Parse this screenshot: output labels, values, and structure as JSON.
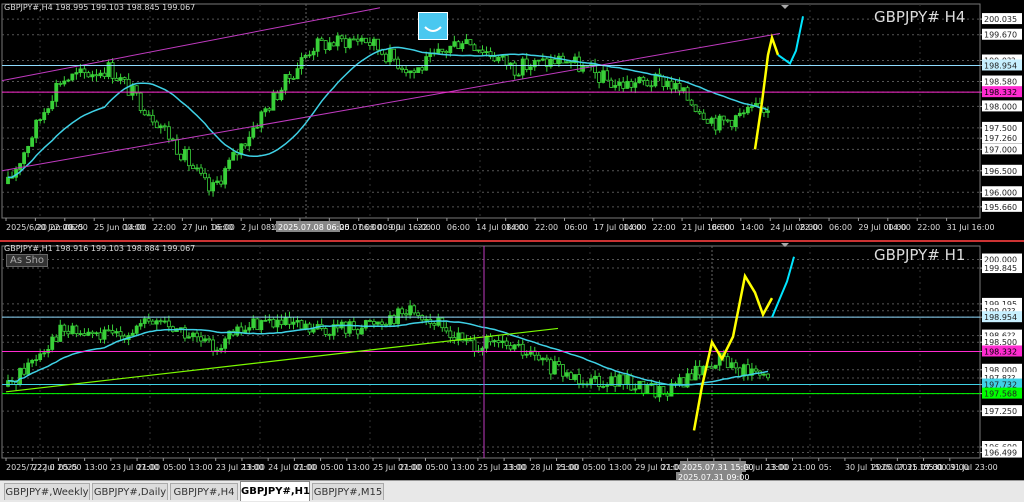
{
  "window": {
    "tabs": [
      {
        "label": "GBPJPY#,Weekly",
        "active": false
      },
      {
        "label": "GBPJPY#,Daily",
        "active": false
      },
      {
        "label": "GBPJPY#,H4",
        "active": false
      },
      {
        "label": "GBPJPY#,H1",
        "active": true
      },
      {
        "label": "GBPJPY#,M15",
        "active": false
      }
    ]
  },
  "as_show_label": "As Sho",
  "colors": {
    "candle": "#39d039",
    "ma": "#3fd1e6",
    "channel": "#c03ac0",
    "magenta_line": "#ff2bd0",
    "trend_green": "#7cfc00",
    "yellow_path": "#ffff00",
    "forecast_path": "#00e5ff",
    "green_level": "#00ff00"
  },
  "pane_h4": {
    "info": "GBPJPY#,H4  198.995 199.103 198.845 199.067",
    "symbol_label": "GBPJPY#  H4",
    "price_min": 195.4,
    "price_max": 200.2,
    "price_ticks": [
      "200.035",
      "199.670",
      "199.0??",
      "198.954",
      "198.580",
      "198.332",
      "198.000",
      "197.500",
      "197.260",
      "197.000",
      "196.500",
      "196.000",
      "195.660"
    ],
    "price_tick_values": [
      200.035,
      199.67,
      199.07,
      198.954,
      198.58,
      198.332,
      198.0,
      197.5,
      197.26,
      197.0,
      196.5,
      196.0,
      195.66
    ],
    "time_labels": [
      "2025/6/20 22:00",
      "20 Jun 2025",
      "06:00",
      "25 Jun 00:00",
      "14:00",
      "22:00",
      "27 Jun 16:00",
      "06:00",
      "2 Jul 08:00",
      "14:00",
      "22:00",
      "2025.07.08 00:00",
      "06:00",
      "9 Jul 16:00",
      "22:00",
      "06:00",
      "14 Jul 08:00",
      "14:00",
      "22:00",
      "06:00",
      "17 Jul 00:00",
      "14:00",
      "22:00",
      "21 Jul 16:00",
      "06:00",
      "14:00",
      "24 Jul 08:00",
      "22:00",
      "06:00",
      "29 Jul 00:00",
      "14:00",
      "22:00",
      "31 Jul 16:00"
    ],
    "crosshair_time": "2025.07.08 06:00"
  },
  "pane_h1": {
    "info": "GBPJPY#,H1  198.916 199.103 198.884 199.067",
    "symbol_label": "GBPJPY#  H1",
    "price_min": 196.4,
    "price_max": 200.1,
    "price_ticks": [
      "200.000",
      "199.845",
      "199.195",
      "199.0??",
      "198.954",
      "198.6??",
      "198.500",
      "198.332",
      "198.000",
      "197.8??",
      "197.732",
      "197.568",
      "197.250",
      "196.600",
      "196.499"
    ],
    "price_tick_values": [
      200.0,
      199.845,
      199.195,
      199.07,
      198.954,
      198.62,
      198.5,
      198.332,
      198.0,
      197.85,
      197.732,
      197.568,
      197.25,
      196.6,
      196.499
    ],
    "time_labels": [
      "2025/7/22 0",
      "22 Jul 2025",
      "05:00",
      "13:00",
      "23 Jul 07:00",
      "21:00",
      "05:00",
      "13:00",
      "23 Jul 23:00",
      "13:00",
      "24 Jul 07:00",
      "21:00",
      "05:00",
      "13:00",
      "25 Jul 07:00",
      "21:00",
      "05:00",
      "13:00",
      "25 Jul 23:00",
      "13:00",
      "28 Jul 15:00",
      "21:00",
      "05:00",
      "13:00",
      "29 Jul 07:00",
      "21:00",
      "05:00",
      "13:00",
      "29 Jul 23:00",
      "13:00",
      "21:00",
      "05:",
      "30 Jul 15:00",
      "2025.07.31 15:00",
      "2025.07.31 09:00",
      "05:00",
      "31 Jul 23:00"
    ],
    "crosshair_time": "2025.07.31 15:00",
    "crosshair_time2": "2025.07.31 09:00"
  }
}
